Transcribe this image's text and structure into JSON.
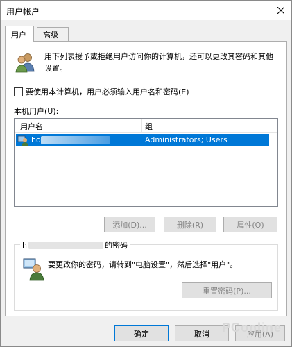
{
  "window": {
    "title": "用户帐户"
  },
  "tabs": [
    {
      "label": "用户"
    },
    {
      "label": "高级"
    }
  ],
  "intro": {
    "text": "用下列表授予或拒绝用户访问你的计算机，还可以更改其密码和其他设置。"
  },
  "require_password": {
    "label": "要使用本计算机，用户必须输入用户名和密码(E)",
    "checked": false
  },
  "local_users": {
    "label": "本机用户(U):",
    "columns": {
      "name": "用户名",
      "group": "组"
    },
    "rows": [
      {
        "name": "ho",
        "group": "Administrators; Users"
      }
    ]
  },
  "user_buttons": {
    "add": "添加(D)...",
    "remove": "删除(R)",
    "properties": "属性(O)"
  },
  "password_group": {
    "legend_prefix": "h",
    "legend_suffix": "的密码",
    "message": "要更改你的密码，请转到\"电脑设置\"，然后选择\"用户\"。",
    "reset_button": "重置密码(P)..."
  },
  "footer": {
    "ok": "确定",
    "cancel": "取消",
    "apply": "应用(A)"
  },
  "watermark": "PConline",
  "colors": {
    "selection": "#0078d7",
    "disabled_text": "#838383"
  }
}
